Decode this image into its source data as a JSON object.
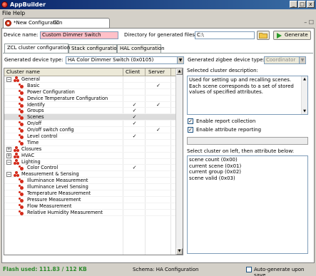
{
  "window": {
    "title": "AppBuilder"
  },
  "menu": [
    "File",
    "Help"
  ],
  "editor_tab": {
    "label": "*New Configuration",
    "close": "⌧"
  },
  "view_controls": "– ☐",
  "form": {
    "device_name_label": "Device name:",
    "device_name_value": "Custom Dimmer Switch",
    "directory_label": "Directory for generated files:",
    "directory_value": "C:\\",
    "generate_label": "Generate"
  },
  "tabs": [
    {
      "label": "ZCL cluster configuration",
      "active": true
    },
    {
      "label": "Stack configuration",
      "active": false
    },
    {
      "label": "HAL configuration",
      "active": false
    }
  ],
  "device_type": {
    "label": "Generated device type:",
    "value": "HA Color Dimmer Switch (0x0105)",
    "zigbee_label": "Generated zigbee device type:",
    "zigbee_value": "Coordinator"
  },
  "tree": {
    "columns": [
      "Cluster name",
      "Client",
      "Server"
    ],
    "check": "✓",
    "rows": [
      {
        "level": 0,
        "kind": "group",
        "expand": "−",
        "name": "General",
        "client": false,
        "server": false
      },
      {
        "level": 1,
        "kind": "cluster",
        "name": "Basic",
        "client": false,
        "server": true
      },
      {
        "level": 1,
        "kind": "cluster",
        "name": "Power Configuration",
        "client": false,
        "server": false
      },
      {
        "level": 1,
        "kind": "cluster",
        "name": "Device Temperature Configuration",
        "client": false,
        "server": false
      },
      {
        "level": 1,
        "kind": "cluster",
        "name": "Identify",
        "client": true,
        "server": true
      },
      {
        "level": 1,
        "kind": "cluster",
        "name": "Groups",
        "client": true,
        "server": false
      },
      {
        "level": 1,
        "kind": "cluster",
        "name": "Scenes",
        "client": true,
        "server": false,
        "selected": true
      },
      {
        "level": 1,
        "kind": "cluster",
        "name": "On/off",
        "client": true,
        "server": false
      },
      {
        "level": 1,
        "kind": "cluster",
        "name": "On/off switch config",
        "client": false,
        "server": true
      },
      {
        "level": 1,
        "kind": "cluster",
        "name": "Level control",
        "client": true,
        "server": false
      },
      {
        "level": 1,
        "kind": "cluster",
        "name": "Time",
        "client": false,
        "server": false
      },
      {
        "level": 0,
        "kind": "group",
        "expand": "+",
        "name": "Closures",
        "client": false,
        "server": false
      },
      {
        "level": 0,
        "kind": "group",
        "expand": "+",
        "name": "HVAC",
        "client": false,
        "server": false
      },
      {
        "level": 0,
        "kind": "group",
        "expand": "−",
        "name": "Lighting",
        "client": false,
        "server": false
      },
      {
        "level": 1,
        "kind": "cluster",
        "name": "Color Control",
        "client": true,
        "server": false
      },
      {
        "level": 0,
        "kind": "group",
        "expand": "−",
        "name": "Measurement & Sensing",
        "client": false,
        "server": false
      },
      {
        "level": 1,
        "kind": "cluster",
        "name": "Illuminance Measurement",
        "client": false,
        "server": false
      },
      {
        "level": 1,
        "kind": "cluster",
        "name": "Illuminance Level Sensing",
        "client": false,
        "server": false
      },
      {
        "level": 1,
        "kind": "cluster",
        "name": "Temperature Measurement",
        "client": false,
        "server": false
      },
      {
        "level": 1,
        "kind": "cluster",
        "name": "Pressure Measurement",
        "client": false,
        "server": false
      },
      {
        "level": 1,
        "kind": "cluster",
        "name": "Flow Measurement",
        "client": false,
        "server": false
      },
      {
        "level": 1,
        "kind": "cluster",
        "name": "Relative Humidity Measurement",
        "client": false,
        "server": false
      }
    ]
  },
  "right_panel": {
    "description_label": "Selected cluster description:",
    "description": "Used for setting up and recalling scenes. Each scene corresponds to a set of stored values of specified attributes.",
    "enable_report": {
      "label": "Enable report collection",
      "checked": true
    },
    "enable_attr": {
      "label": "Enable attribute reporting",
      "checked": true
    },
    "attributes_label": "Select cluster on left, then attribute below:",
    "attributes": [
      "scene count  (0x00)",
      "current scene  (0x01)",
      "current group  (0x02)",
      "scene valid  (0x03)"
    ]
  },
  "status": {
    "flash": "Flash used: 111.83 / 112 KB",
    "schema": "Schema: HA Configuration",
    "auto_generate": "Auto-generate upon save"
  },
  "colors": {
    "flash_text": "#2e8b2e",
    "pink_field": "#ffc0c8",
    "title_gradient_start": "#0a246a"
  }
}
